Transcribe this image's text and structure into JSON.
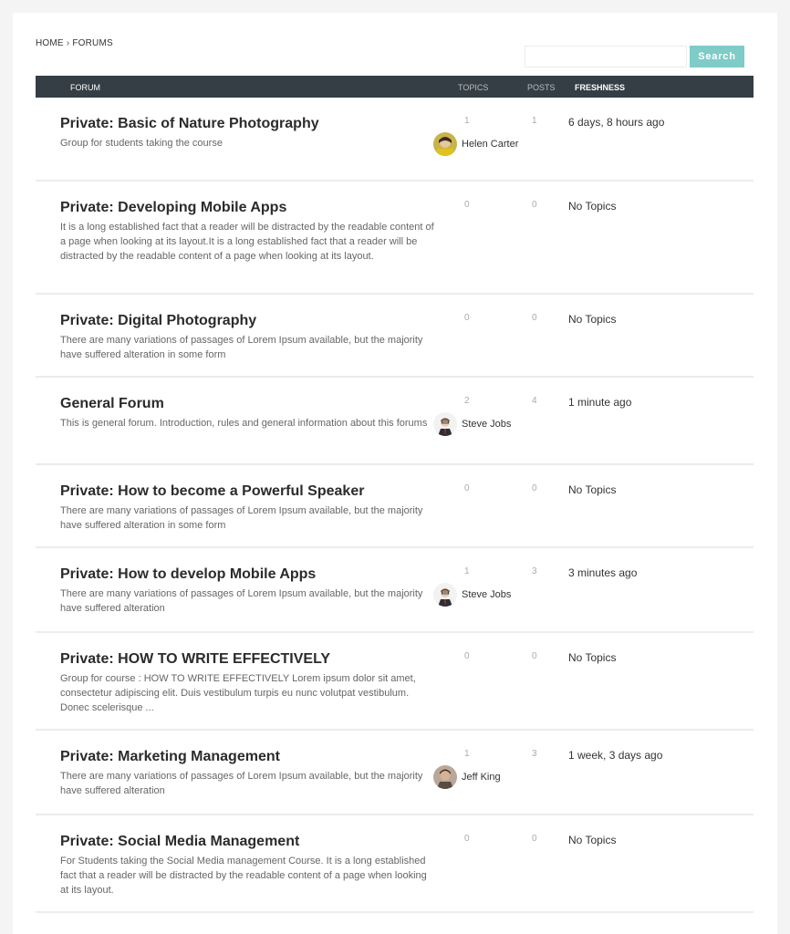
{
  "breadcrumb": {
    "home": "HOME",
    "separator": "›",
    "current": "FORUMS"
  },
  "search": {
    "button_label": "Search",
    "value": "",
    "placeholder": ""
  },
  "table_header": {
    "forum": "FORUM",
    "topics": "TOPICS",
    "posts": "POSTS",
    "freshness": "FRESHNESS"
  },
  "colors": {
    "header_bg": "#353e45",
    "search_button": "#7fcbc8"
  },
  "forums": [
    {
      "title": "Private: Basic of Nature Photography",
      "description": "Group for students taking the course",
      "topics": "1",
      "posts": "1",
      "freshness": "6 days, 8 hours ago",
      "user": "Helen Carter",
      "avatar": "helen"
    },
    {
      "title": "Private: Developing Mobile Apps",
      "description": "It is a long established fact that a reader will be distracted by the readable content of a page when looking at its layout.It is a long established fact that a reader will be distracted by the readable content of a page when looking at its layout.",
      "topics": "0",
      "posts": "0",
      "freshness": "No Topics",
      "user": "",
      "avatar": ""
    },
    {
      "title": "Private: Digital Photography",
      "description": "There are many variations of passages of Lorem Ipsum available, but the majority have suffered alteration in some form",
      "topics": "0",
      "posts": "0",
      "freshness": "No Topics",
      "user": "",
      "avatar": ""
    },
    {
      "title": "General Forum",
      "description": "This is general forum. Introduction, rules and general information about this forums",
      "topics": "2",
      "posts": "4",
      "freshness": "1 minute ago",
      "user": "Steve Jobs",
      "avatar": "steve"
    },
    {
      "title": "Private: How to become a Powerful Speaker",
      "description": "There are many variations of passages of Lorem Ipsum available, but the majority have suffered alteration in some form",
      "topics": "0",
      "posts": "0",
      "freshness": "No Topics",
      "user": "",
      "avatar": ""
    },
    {
      "title": "Private: How to develop Mobile Apps",
      "description": "There are many variations of passages of Lorem Ipsum available, but the majority have suffered alteration",
      "topics": "1",
      "posts": "3",
      "freshness": "3 minutes ago",
      "user": "Steve Jobs",
      "avatar": "steve"
    },
    {
      "title": "Private: HOW TO WRITE EFFECTIVELY",
      "description": "Group for course : HOW TO WRITE EFFECTIVELY Lorem ipsum dolor sit amet, consectetur adipiscing elit. Duis vestibulum turpis eu nunc volutpat vestibulum. Donec scelerisque ...",
      "topics": "0",
      "posts": "0",
      "freshness": "No Topics",
      "user": "",
      "avatar": ""
    },
    {
      "title": "Private: Marketing Management",
      "description": "There are many variations of passages of Lorem Ipsum available, but the majority have suffered alteration",
      "topics": "1",
      "posts": "3",
      "freshness": "1 week, 3 days ago",
      "user": "Jeff King",
      "avatar": "jeff"
    },
    {
      "title": "Private: Social Media Management",
      "description": "For Students taking the Social Media management Course. It is a long established fact that a reader will be distracted by the readable content of a page when looking at its layout.",
      "topics": "0",
      "posts": "0",
      "freshness": "No Topics",
      "user": "",
      "avatar": ""
    }
  ]
}
